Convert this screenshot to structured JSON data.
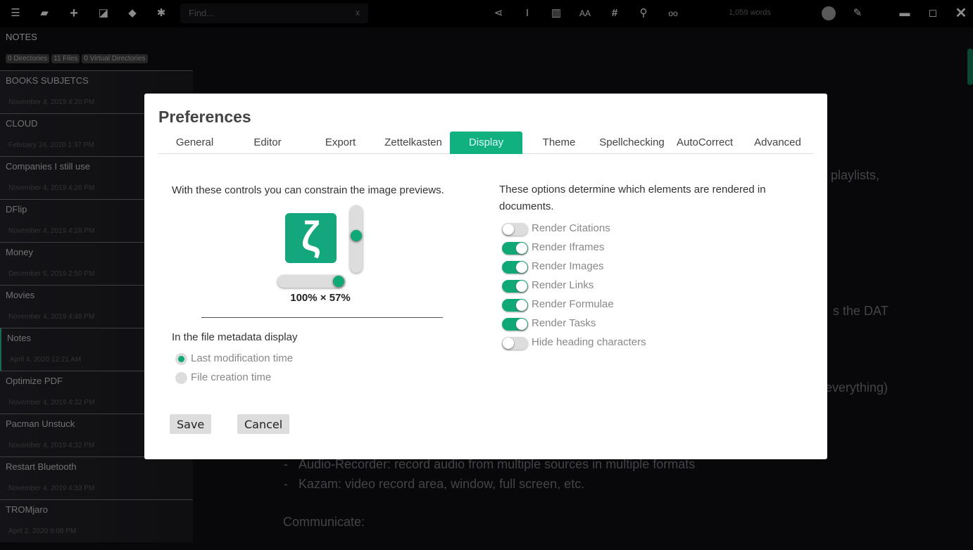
{
  "toolbar": {
    "icons": [
      "menu-icon",
      "folder-open-icon",
      "plus-icon",
      "image-icon",
      "tag-icon",
      "gear-icon",
      "share-icon",
      "text-cursor-icon",
      "trash-icon",
      "font-size-icon",
      "hashtag-icon",
      "search-icon",
      "glasses-icon",
      "paperclip-icon",
      "minimize-icon",
      "maximize-icon",
      "close-icon"
    ],
    "find_placeholder": "Find...",
    "find_clear": "x",
    "word_count": "1,059 words"
  },
  "sidebar": {
    "title": "NOTES",
    "badges": [
      "0 Directories",
      "11 Files",
      "0 Virtual Directories"
    ],
    "items": [
      {
        "title": "BOOKS SUBJETCS",
        "date": "November 4, 2019 4:20 PM"
      },
      {
        "title": "CLOUD",
        "date": "February 24, 2020 1:37 PM"
      },
      {
        "title": "Companies I still use",
        "date": "November 4, 2019 4:26 PM"
      },
      {
        "title": "DFlip",
        "date": "November 4, 2019 4:28 PM"
      },
      {
        "title": "Money",
        "date": "December 5, 2019 2:50 PM"
      },
      {
        "title": "Movies",
        "date": "November 4, 2019 4:48 PM"
      },
      {
        "title": "Notes",
        "date": "April 4, 2020 12:21 AM",
        "active": true
      },
      {
        "title": "Optimize PDF",
        "date": "November 4, 2019 4:32 PM"
      },
      {
        "title": "Pacman Unstuck",
        "date": "November 4, 2019 4:32 PM"
      },
      {
        "title": "Restart Bluetooth",
        "date": "November 4, 2019 4:33 PM"
      },
      {
        "title": "TROMjaro",
        "date": "April 2, 2020 9:08 PM"
      }
    ]
  },
  "editor": {
    "fragments": [
      "playlists,",
      "s the DAT",
      "everything)"
    ],
    "bullets": [
      "Audio-Recorder: record audio from multiple sources in multiple formats",
      "Kazam: video record area, window, full screen, etc."
    ],
    "heading": "Communicate:"
  },
  "dialog": {
    "title": "Preferences",
    "tabs": [
      "General",
      "Editor",
      "Export",
      "Zettelkasten",
      "Display",
      "Theme",
      "Spellchecking",
      "AutoCorrect",
      "Advanced"
    ],
    "active_tab": "Display",
    "image_intro": "With these controls you can constrain the image previews.",
    "preview_glyph": "ζ",
    "width_percent": 100,
    "height_percent": 57,
    "size_label": "100% × 57%",
    "metadata_label": "In the file metadata display",
    "metadata_options": [
      {
        "label": "Last modification time",
        "selected": true
      },
      {
        "label": "File creation time",
        "selected": false
      }
    ],
    "render_intro": "These options determine which elements are rendered in documents.",
    "render_options": [
      {
        "label": "Render Citations",
        "on": false
      },
      {
        "label": "Render Iframes",
        "on": true
      },
      {
        "label": "Render Images",
        "on": true
      },
      {
        "label": "Render Links",
        "on": true
      },
      {
        "label": "Render Formulae",
        "on": true
      },
      {
        "label": "Render Tasks",
        "on": true
      },
      {
        "label": "Hide heading characters",
        "on": false
      }
    ],
    "save": "Save",
    "cancel": "Cancel"
  },
  "colors": {
    "accent": "#11b07f",
    "background": "#0b0b0f"
  }
}
